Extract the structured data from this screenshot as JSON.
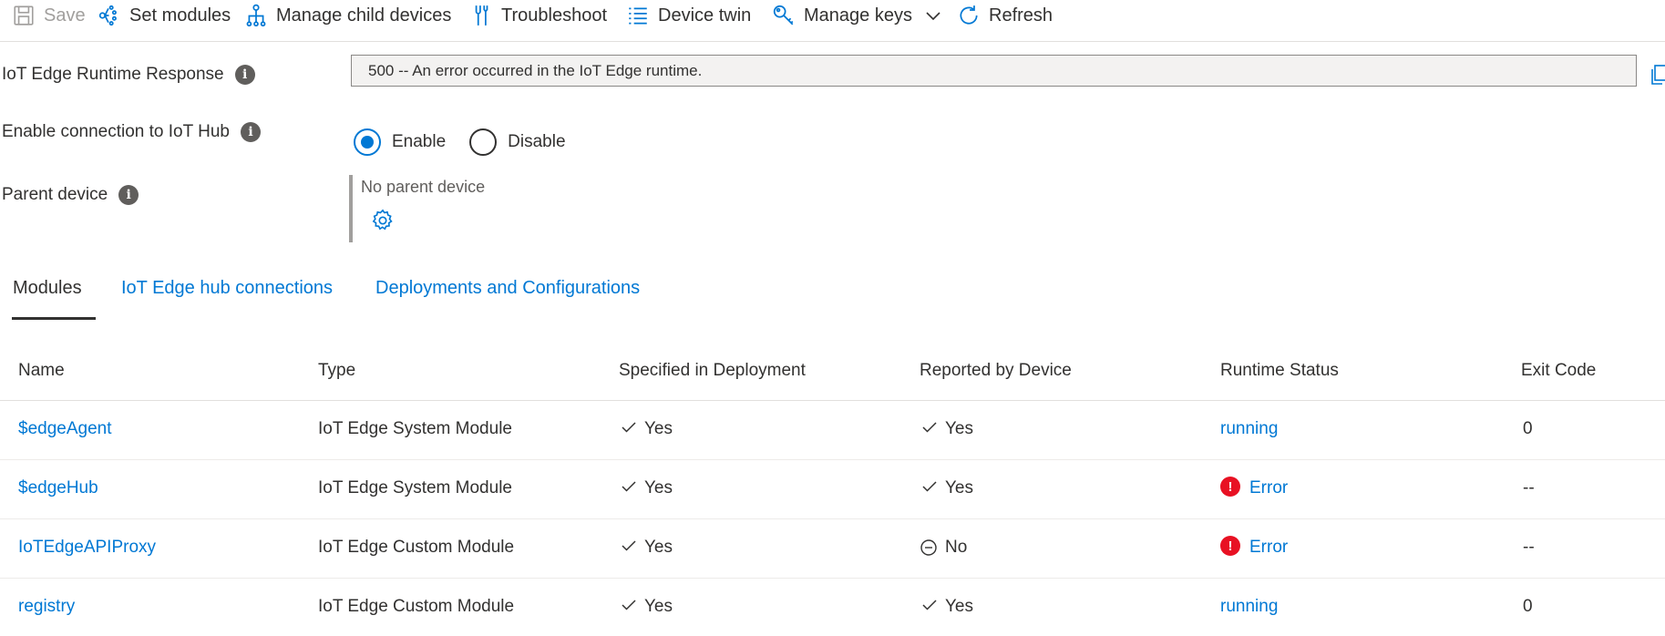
{
  "toolbar": {
    "save": "Save",
    "set_modules": "Set modules",
    "manage_child_devices": "Manage child devices",
    "troubleshoot": "Troubleshoot",
    "device_twin": "Device twin",
    "manage_keys": "Manage keys",
    "refresh": "Refresh"
  },
  "form": {
    "runtime_label": "IoT Edge Runtime Response",
    "runtime_value": "500 -- An error occurred in the IoT Edge runtime.",
    "connection_label": "Enable connection to IoT Hub",
    "enable_label": "Enable",
    "disable_label": "Disable",
    "connection_selected": "Enable",
    "parent_label": "Parent device",
    "parent_value": "No parent device"
  },
  "tabs": {
    "modules": "Modules",
    "hub_connections": "IoT Edge hub connections",
    "deployments": "Deployments and Configurations",
    "active": "Modules"
  },
  "table": {
    "headers": {
      "name": "Name",
      "type": "Type",
      "specified": "Specified in Deployment",
      "reported": "Reported by Device",
      "status": "Runtime Status",
      "exit": "Exit Code"
    },
    "rows": [
      {
        "name": "$edgeAgent",
        "type": "IoT Edge System Module",
        "specified": "Yes",
        "reported": "Yes",
        "status": "running",
        "exit": "0"
      },
      {
        "name": "$edgeHub",
        "type": "IoT Edge System Module",
        "specified": "Yes",
        "reported": "Yes",
        "status": "Error",
        "exit": "--"
      },
      {
        "name": "IoTEdgeAPIProxy",
        "type": "IoT Edge Custom Module",
        "specified": "Yes",
        "reported": "No",
        "status": "Error",
        "exit": "--"
      },
      {
        "name": "registry",
        "type": "IoT Edge Custom Module",
        "specified": "Yes",
        "reported": "Yes",
        "status": "running",
        "exit": "0"
      }
    ]
  },
  "colors": {
    "accent": "#0078d4",
    "error": "#e81123",
    "text": "#323130",
    "disabled": "#a19f9d"
  },
  "icons": {
    "save": "save-icon",
    "set_modules": "set-modules-icon",
    "manage_child_devices": "hierarchy-icon",
    "troubleshoot": "wrench-icon",
    "device_twin": "list-icon",
    "manage_keys": "key-icon",
    "refresh": "refresh-icon",
    "info": "info-icon",
    "gear": "gear-icon",
    "check": "checkmark-icon",
    "no": "minus-circle-icon",
    "error": "error-icon"
  }
}
